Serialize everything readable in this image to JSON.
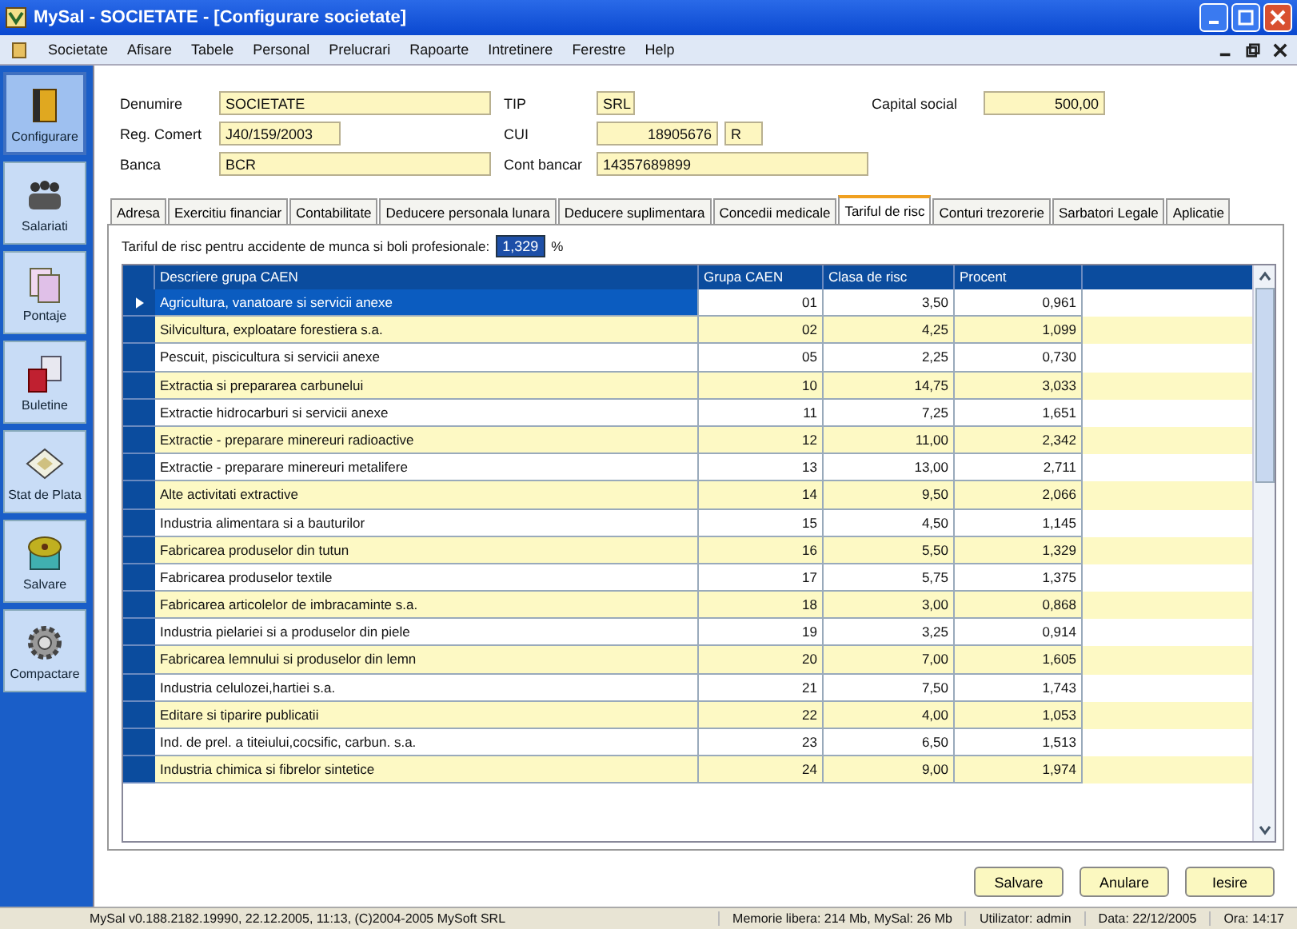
{
  "window": {
    "title": "MySal - SOCIETATE - [Configurare societate]"
  },
  "menu": [
    "Societate",
    "Afisare",
    "Tabele",
    "Personal",
    "Prelucrari",
    "Rapoarte",
    "Intretinere",
    "Ferestre",
    "Help"
  ],
  "sidebar": {
    "items": [
      {
        "label": "Configurare",
        "kind": "book",
        "selected": true
      },
      {
        "label": "Salariati",
        "kind": "people",
        "selected": false
      },
      {
        "label": "Pontaje",
        "kind": "pages",
        "selected": false
      },
      {
        "label": "Buletine",
        "kind": "cards",
        "selected": false
      },
      {
        "label": "Stat de Plata",
        "kind": "diamond",
        "selected": false
      },
      {
        "label": "Salvare",
        "kind": "disk",
        "selected": false
      },
      {
        "label": "Compactare",
        "kind": "gear",
        "selected": false
      }
    ]
  },
  "form": {
    "rows": [
      [
        {
          "label": "Denumire",
          "value": "SOCIETATE"
        },
        {
          "label": "TIP",
          "value": "SRL"
        },
        {
          "label": "Capital social",
          "value": "500,00"
        }
      ],
      [
        {
          "label": "Reg. Comert",
          "value": "J40/159/2003"
        },
        {
          "label": "CUI",
          "value": "18905676",
          "extra": "R"
        }
      ],
      [
        {
          "label": "Banca",
          "value": "BCR"
        },
        {
          "label": "Cont bancar",
          "value": "14357689899"
        }
      ]
    ]
  },
  "tabs": [
    {
      "label": "Adresa",
      "selected": false
    },
    {
      "label": "Exercitiu financiar",
      "selected": false
    },
    {
      "label": "Contabilitate",
      "selected": false
    },
    {
      "label": "Deducere personala lunara",
      "selected": false
    },
    {
      "label": "Deducere suplimentara",
      "selected": false
    },
    {
      "label": "Concedii medicale",
      "selected": false
    },
    {
      "label": "Tariful de risc",
      "selected": true
    },
    {
      "label": "Conturi trezorerie",
      "selected": false
    },
    {
      "label": "Sarbatori Legale",
      "selected": false
    },
    {
      "label": "Aplicatie",
      "selected": false
    }
  ],
  "tariff": {
    "label": "Tariful de risc pentru accidente de munca si boli profesionale:",
    "value": "1,329",
    "unit": "%"
  },
  "table": {
    "columns": [
      "Descriere grupa CAEN",
      "Grupa CAEN",
      "Clasa de risc",
      "Procent"
    ],
    "rows": [
      {
        "cells": [
          "Agricultura, vanatoare si servicii anexe",
          "01",
          "3,50",
          "0,961"
        ],
        "selected": true
      },
      {
        "cells": [
          "Silvicultura, exploatare forestiera s.a.",
          "02",
          "4,25",
          "1,099"
        ],
        "selected": false
      },
      {
        "cells": [
          "Pescuit, piscicultura si servicii anexe",
          "05",
          "2,25",
          "0,730"
        ],
        "selected": false
      },
      {
        "cells": [
          "Extractia si prepararea carbunelui",
          "10",
          "14,75",
          "3,033"
        ],
        "selected": false
      },
      {
        "cells": [
          "Extractie hidrocarburi si servicii anexe",
          "11",
          "7,25",
          "1,651"
        ],
        "selected": false
      },
      {
        "cells": [
          "Extractie - preparare minereuri radioactive",
          "12",
          "11,00",
          "2,342"
        ],
        "selected": false
      },
      {
        "cells": [
          "Extractie - preparare minereuri metalifere",
          "13",
          "13,00",
          "2,711"
        ],
        "selected": false
      },
      {
        "cells": [
          "Alte activitati extractive",
          "14",
          "9,50",
          "2,066"
        ],
        "selected": false
      },
      {
        "cells": [
          "Industria alimentara si a bauturilor",
          "15",
          "4,50",
          "1,145"
        ],
        "selected": false
      },
      {
        "cells": [
          "Fabricarea produselor din tutun",
          "16",
          "5,50",
          "1,329"
        ],
        "selected": false
      },
      {
        "cells": [
          "Fabricarea produselor textile",
          "17",
          "5,75",
          "1,375"
        ],
        "selected": false
      },
      {
        "cells": [
          "Fabricarea articolelor de imbracaminte s.a.",
          "18",
          "3,00",
          "0,868"
        ],
        "selected": false
      },
      {
        "cells": [
          "Industria pielariei si a produselor din piele",
          "19",
          "3,25",
          "0,914"
        ],
        "selected": false
      },
      {
        "cells": [
          "Fabricarea lemnului si produselor din lemn",
          "20",
          "7,00",
          "1,605"
        ],
        "selected": false
      },
      {
        "cells": [
          "Industria celulozei,hartiei s.a.",
          "21",
          "7,50",
          "1,743"
        ],
        "selected": false
      },
      {
        "cells": [
          "Editare si tiparire publicatii",
          "22",
          "4,00",
          "1,053"
        ],
        "selected": false
      },
      {
        "cells": [
          "Ind. de prel. a titeiului,cocsific, carbun. s.a.",
          "23",
          "6,50",
          "1,513"
        ],
        "selected": false
      },
      {
        "cells": [
          "Industria chimica si fibrelor sintetice",
          "24",
          "9,00",
          "1,974"
        ],
        "selected": false
      }
    ]
  },
  "buttons": [
    "Salvare",
    "Anulare",
    "Iesire"
  ],
  "status_bar": [
    "MySal v0.188.2182.19990, 22.12.2005, 11:13, (C)2004-2005 MySoft SRL",
    "Memorie libera: 214 Mb, MySal: 26 Mb",
    "Utilizator: admin",
    "Data: 22/12/2005",
    "Ora: 14:17"
  ]
}
